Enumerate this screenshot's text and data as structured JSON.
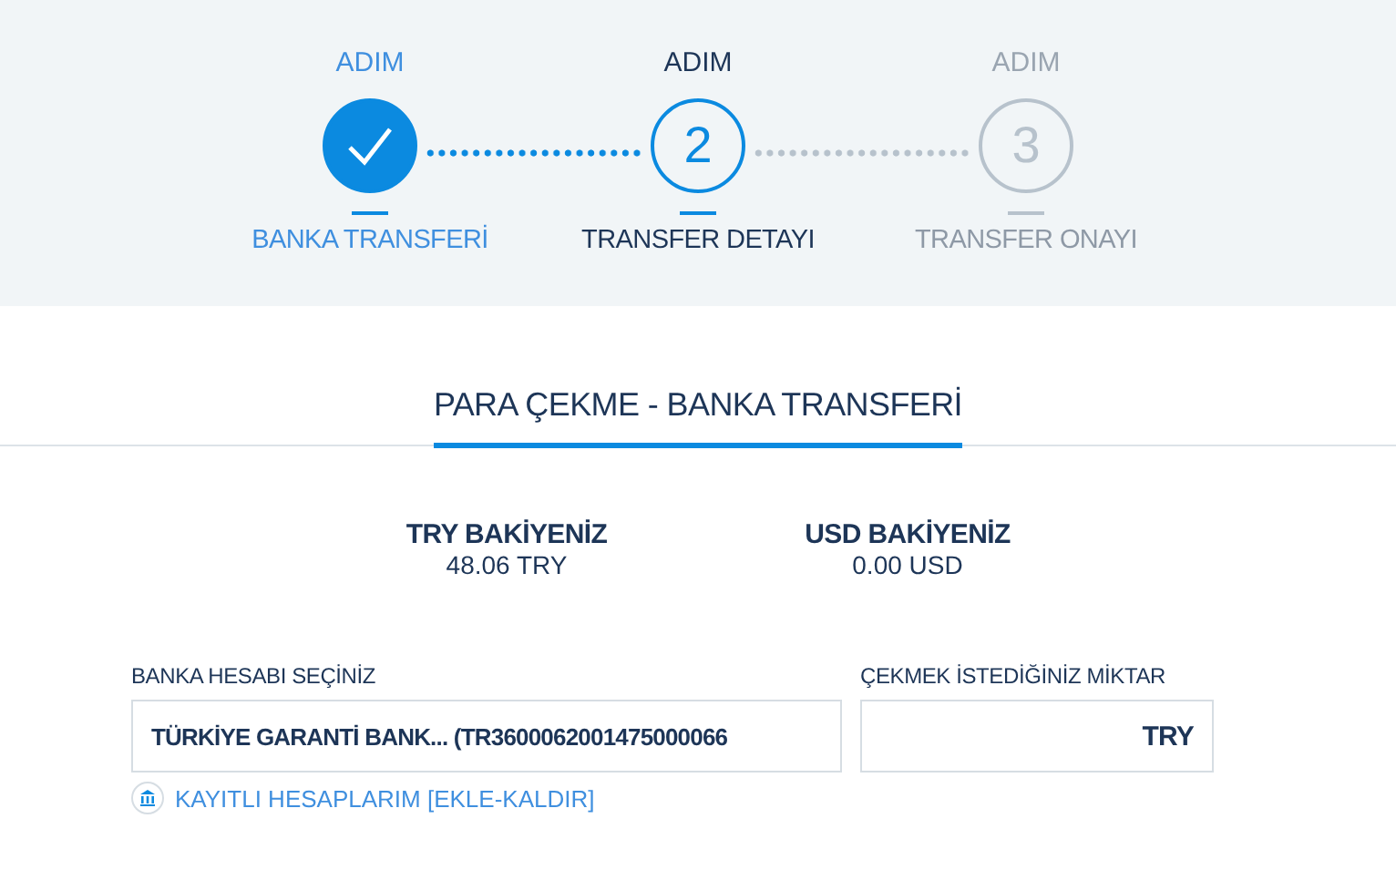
{
  "steps": [
    {
      "caption": "ADIM",
      "completed": true,
      "selected": false,
      "label": "BANKA TRANSFERİ"
    },
    {
      "caption": "ADIM",
      "completed": false,
      "selected": true,
      "number": "2",
      "label": "TRANSFER DETAYI"
    },
    {
      "caption": "ADIM",
      "completed": false,
      "selected": false,
      "number": "3",
      "label": "TRANSFER ONAYI"
    }
  ],
  "title": "PARA ÇEKME - BANKA TRANSFERİ",
  "balances": [
    {
      "label": "TRY BAKİYENİZ",
      "value": "48.06 TRY"
    },
    {
      "label": "USD BAKİYENİZ",
      "value": "0.00 USD"
    }
  ],
  "bank_field": {
    "label": "BANKA HESABI SEÇİNİZ",
    "value": "TÜRKİYE GARANTİ BANK... (TR3600062001475000066"
  },
  "amount_field": {
    "label": "ÇEKMEK İSTEDİĞİNİZ MİKTAR",
    "currency": "TRY"
  },
  "saved_accounts_link": "KAYITLI HESAPLARIM [EKLE-KALDIR]"
}
